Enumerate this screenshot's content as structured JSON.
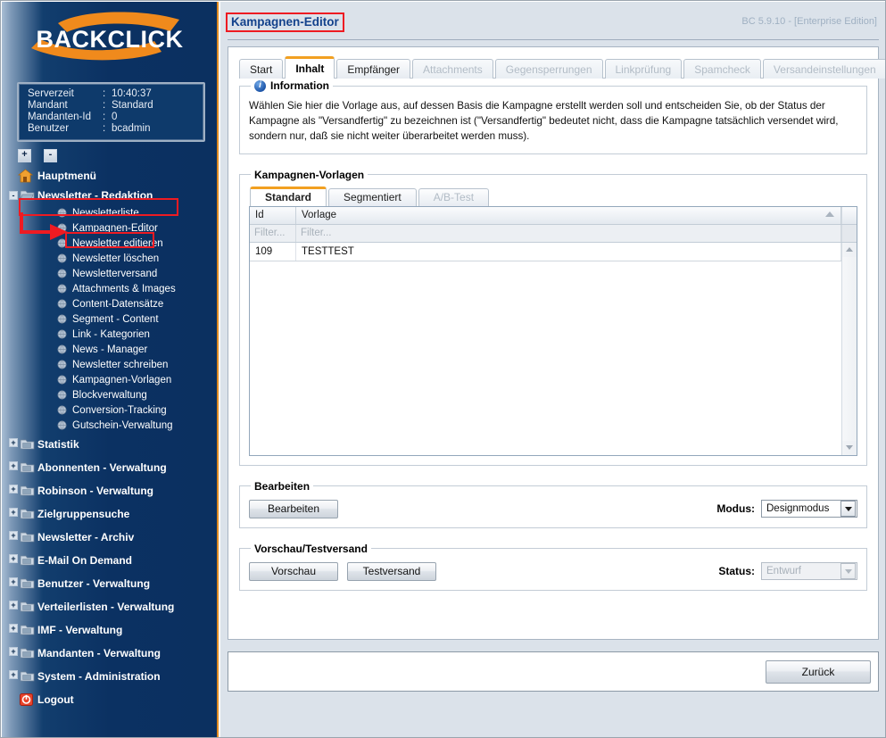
{
  "branding": {
    "logo_text": "BACKCLICK"
  },
  "version_label": "BC 5.9.10 - [Enterprise Edition]",
  "page_title": "Kampagnen-Editor",
  "server_info": {
    "rows": [
      {
        "key": "Serverzeit",
        "sep": ":",
        "value": "10:40:37"
      },
      {
        "key": "Mandant",
        "sep": ":",
        "value": "Standard"
      },
      {
        "key": "Mandanten-Id",
        "sep": ":",
        "value": "0"
      },
      {
        "key": "Benutzer",
        "sep": ":",
        "value": "bcadmin"
      }
    ]
  },
  "tree_controls": {
    "expand_all": "+",
    "collapse_all": "-"
  },
  "sidebar": {
    "home": {
      "label": "Hauptmenü"
    },
    "active_group": {
      "label": "Newsletter - Redaktion",
      "expander": "-"
    },
    "active_group_items": [
      {
        "label": "Newsletterliste"
      },
      {
        "label": "Kampagnen-Editor"
      },
      {
        "label": "Newsletter editieren"
      },
      {
        "label": "Newsletter löschen"
      },
      {
        "label": "Newsletterversand"
      },
      {
        "label": "Attachments & Images"
      },
      {
        "label": "Content-Datensätze"
      },
      {
        "label": "Segment - Content"
      },
      {
        "label": "Link - Kategorien"
      },
      {
        "label": "News - Manager"
      },
      {
        "label": "Newsletter schreiben"
      },
      {
        "label": "Kampagnen-Vorlagen"
      },
      {
        "label": "Blockverwaltung"
      },
      {
        "label": "Conversion-Tracking"
      },
      {
        "label": "Gutschein-Verwaltung"
      }
    ],
    "groups": [
      {
        "label": "Statistik",
        "expander": "+"
      },
      {
        "label": "Abonnenten - Verwaltung",
        "expander": "+"
      },
      {
        "label": "Robinson - Verwaltung",
        "expander": "+"
      },
      {
        "label": "Zielgruppensuche",
        "expander": "+"
      },
      {
        "label": "Newsletter - Archiv",
        "expander": "+"
      },
      {
        "label": "E-Mail On Demand",
        "expander": "+"
      },
      {
        "label": "Benutzer - Verwaltung",
        "expander": "+"
      },
      {
        "label": "Verteilerlisten - Verwaltung",
        "expander": "+"
      },
      {
        "label": "IMF - Verwaltung",
        "expander": "+"
      },
      {
        "label": "Mandanten - Verwaltung",
        "expander": "+"
      },
      {
        "label": "System - Administration",
        "expander": "+"
      }
    ],
    "logout": {
      "label": "Logout"
    }
  },
  "tabs": [
    {
      "label": "Start",
      "state": "enabled"
    },
    {
      "label": "Inhalt",
      "state": "active"
    },
    {
      "label": "Empfänger",
      "state": "enabled"
    },
    {
      "label": "Attachments",
      "state": "disabled"
    },
    {
      "label": "Gegensperrungen",
      "state": "disabled"
    },
    {
      "label": "Linkprüfung",
      "state": "disabled"
    },
    {
      "label": "Spamcheck",
      "state": "disabled"
    },
    {
      "label": "Versandeinstellungen",
      "state": "disabled"
    }
  ],
  "tab_scroll": {
    "left": "◄",
    "right": "►"
  },
  "information": {
    "legend": "Information",
    "icon": "info-icon",
    "text": "Wählen Sie hier die Vorlage aus, auf dessen Basis die Kampagne erstellt werden soll und entscheiden Sie, ob der Status der Kampagne als \"Versandfertig\" zu bezeichnen ist (\"Versandfertig\" bedeutet nicht, dass die Kampagne tatsächlich versendet wird, sondern nur, daß sie nicht weiter überarbeitet werden muss)."
  },
  "templates": {
    "legend": "Kampagnen-Vorlagen",
    "tabs": [
      {
        "label": "Standard",
        "state": "active"
      },
      {
        "label": "Segmentiert",
        "state": "enabled"
      },
      {
        "label": "A/B-Test",
        "state": "disabled"
      }
    ],
    "columns": [
      {
        "key": "id",
        "label": "Id"
      },
      {
        "key": "vorlage",
        "label": "Vorlage"
      }
    ],
    "filter_placeholder": "Filter...",
    "rows": [
      {
        "id": "109",
        "vorlage": "TESTTEST"
      }
    ]
  },
  "edit_section": {
    "legend": "Bearbeiten",
    "button": "Bearbeiten",
    "mode_label": "Modus:",
    "mode_value": "Designmodus"
  },
  "preview_section": {
    "legend": "Vorschau/Testversand",
    "preview_button": "Vorschau",
    "test_button": "Testversand",
    "status_label": "Status:",
    "status_value": "Entwurf"
  },
  "footer": {
    "back_button": "Zurück"
  },
  "colors": {
    "sidebar_bg": "#0b3060",
    "sidebar_border": "#e08a20",
    "accent_orange": "#f2a021",
    "title_blue": "#13428c",
    "annotation_red": "#ee1b22",
    "main_bg": "#dbe2ea"
  }
}
